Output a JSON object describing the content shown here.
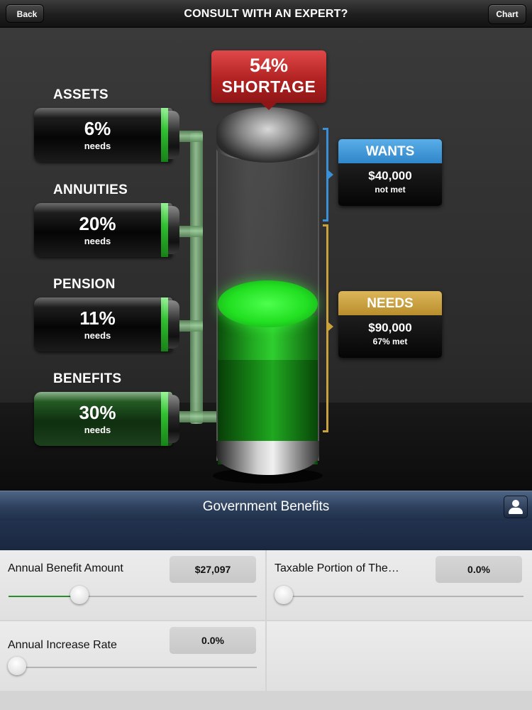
{
  "nav": {
    "back_label": "Back",
    "title": "CONSULT WITH AN EXPERT?",
    "chart_label": "Chart"
  },
  "infographic": {
    "shortage": {
      "percent": "54%",
      "label": "SHORTAGE"
    },
    "sources": [
      {
        "label": "ASSETS",
        "percent": "6%",
        "sub": "needs"
      },
      {
        "label": "ANNUITIES",
        "percent": "20%",
        "sub": "needs"
      },
      {
        "label": "PENSION",
        "percent": "11%",
        "sub": "needs"
      },
      {
        "label": "BENEFITS",
        "percent": "30%",
        "sub": "needs"
      }
    ],
    "wants": {
      "title": "WANTS",
      "amount": "$40,000",
      "status": "not met",
      "color": "#3b8fd4"
    },
    "needs": {
      "title": "NEEDS",
      "amount": "$90,000",
      "status": "67% met",
      "color": "#c9a23c"
    },
    "accent_green": "#2ed62e",
    "shortage_color": "#c62828"
  },
  "section": {
    "title": "Government Benefits",
    "icon": "person-icon"
  },
  "form": {
    "annual_benefit": {
      "label": "Annual Benefit Amount",
      "value": "$27,097",
      "slider_fraction": 0.28
    },
    "taxable_portion": {
      "label": "Taxable Portion of The…",
      "value": "0.0%",
      "slider_fraction": 0.0
    },
    "annual_increase": {
      "label": "Annual Increase Rate",
      "value": "0.0%",
      "slider_fraction": 0.0
    }
  }
}
